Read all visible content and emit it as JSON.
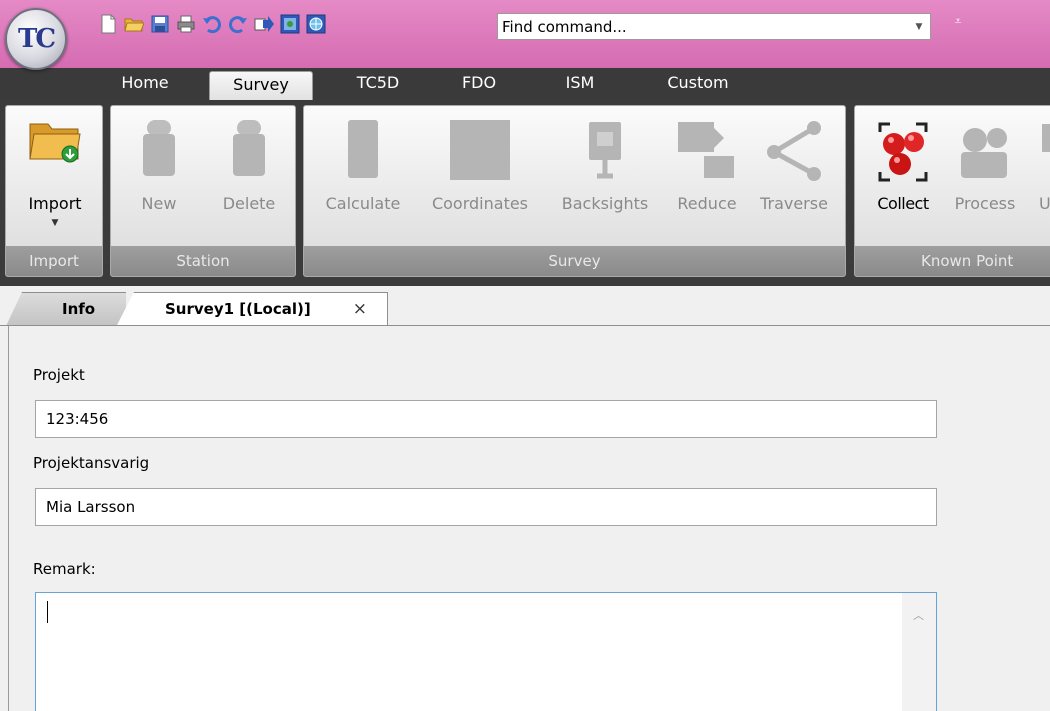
{
  "app": {
    "logo_text": "TC"
  },
  "quick_access": {
    "icons": [
      "new-file-icon",
      "open-folder-icon",
      "save-icon",
      "print-icon",
      "undo-icon",
      "redo-icon",
      "export-icon",
      "map-icon",
      "globe-icon"
    ],
    "find_command": {
      "value": "Find command..."
    }
  },
  "ribbon_tabs": [
    {
      "label": "Home",
      "active": false
    },
    {
      "label": "Survey",
      "active": true
    },
    {
      "label": "TC5D",
      "active": false
    },
    {
      "label": "FDO",
      "active": false
    },
    {
      "label": "ISM",
      "active": false
    },
    {
      "label": "Custom",
      "active": false
    }
  ],
  "ribbon_groups": {
    "import": {
      "title": "Import",
      "buttons": [
        {
          "label": "Import",
          "enabled": true
        }
      ]
    },
    "station": {
      "title": "Station",
      "buttons": [
        {
          "label": "New",
          "enabled": false
        },
        {
          "label": "Delete",
          "enabled": false
        }
      ]
    },
    "survey": {
      "title": "Survey",
      "buttons": [
        {
          "label": "Calculate",
          "enabled": false
        },
        {
          "label": "Coordinates",
          "enabled": false
        },
        {
          "label": "Backsights",
          "enabled": false
        },
        {
          "label": "Reduce",
          "enabled": false
        },
        {
          "label": "Traverse",
          "enabled": false
        }
      ]
    },
    "known_points": {
      "title": "Known Point",
      "buttons": [
        {
          "label": "Collect",
          "enabled": true
        },
        {
          "label": "Process",
          "enabled": false
        },
        {
          "label": "U",
          "enabled": false
        }
      ]
    }
  },
  "doc_tabs": [
    {
      "label": "Info",
      "active": false
    },
    {
      "label": "Survey1 [(Local)]",
      "active": true,
      "close": "×"
    }
  ],
  "form": {
    "projekt": {
      "label": "Projekt",
      "value": "123:456"
    },
    "projektansvarig": {
      "label": "Projektansvarig",
      "value": "Mia Larsson"
    },
    "remark": {
      "label": "Remark:",
      "value": ""
    }
  },
  "colors": {
    "title_bar": "#d56cb2",
    "ribbon_bg": "#3b3b3b",
    "group_footer": "#8a8a8a",
    "remark_border": "#6aa2d8"
  }
}
